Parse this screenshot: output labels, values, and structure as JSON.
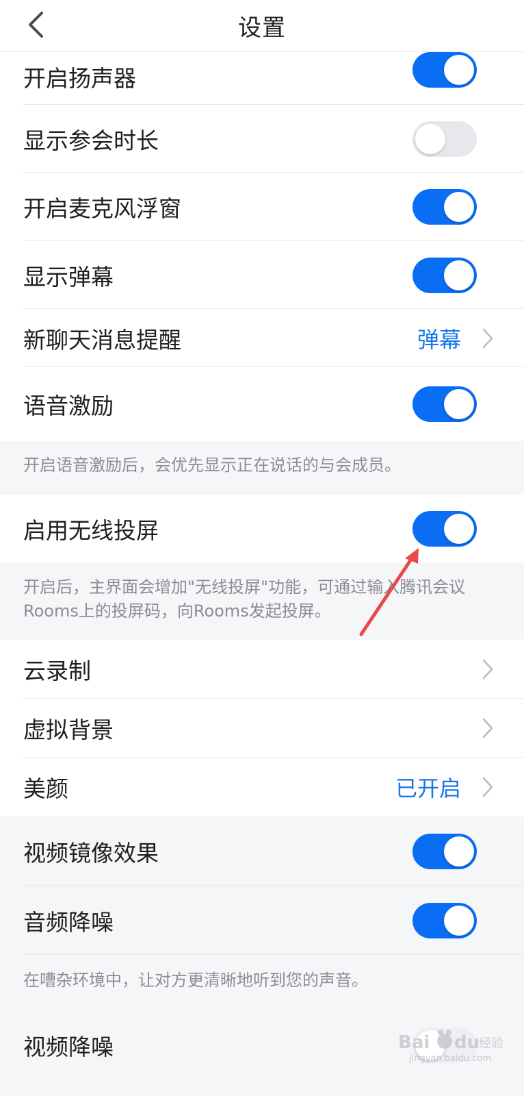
{
  "header": {
    "title": "设置",
    "back_icon": "chevron-left-icon"
  },
  "settings": {
    "speaker": {
      "label": "开启扬声器",
      "enabled": true
    },
    "show_duration": {
      "label": "显示参会时长",
      "enabled": false
    },
    "mic_float": {
      "label": "开启麦克风浮窗",
      "enabled": true
    },
    "danmaku": {
      "label": "显示弹幕",
      "enabled": true
    },
    "new_chat": {
      "label": "新聊天消息提醒",
      "value": "弹幕"
    },
    "voice_motivation": {
      "label": "语音激励",
      "enabled": true
    },
    "voice_motivation_note": "开启语音激励后，会优先显示正在说话的与会成员。",
    "wireless_cast": {
      "label": "启用无线投屏",
      "enabled": true
    },
    "wireless_cast_note_line1": "开启后，主界面会增加\"无线投屏\"功能，可通过输入腾讯会议",
    "wireless_cast_note_line2": "Rooms上的投屏码，向Rooms发起投屏。",
    "cloud_record": {
      "label": "云录制"
    },
    "virtual_bg": {
      "label": "虚拟背景"
    },
    "beauty": {
      "label": "美颜",
      "value": "已开启"
    },
    "video_mirror": {
      "label": "视频镜像效果",
      "enabled": true
    },
    "audio_denoise": {
      "label": "音频降噪",
      "enabled": true
    },
    "audio_denoise_note": "在嘈杂环境中，让对方更清晰地听到您的声音。",
    "video_denoise": {
      "label": "视频降噪",
      "enabled": false
    }
  },
  "watermark": {
    "text": "jingyan.baidu.com",
    "logo": "baidu-jingyan-logo"
  },
  "colors": {
    "accent": "#0a6ef5",
    "link_value": "#1677e8",
    "annotation_arrow": "#e84a4a"
  }
}
